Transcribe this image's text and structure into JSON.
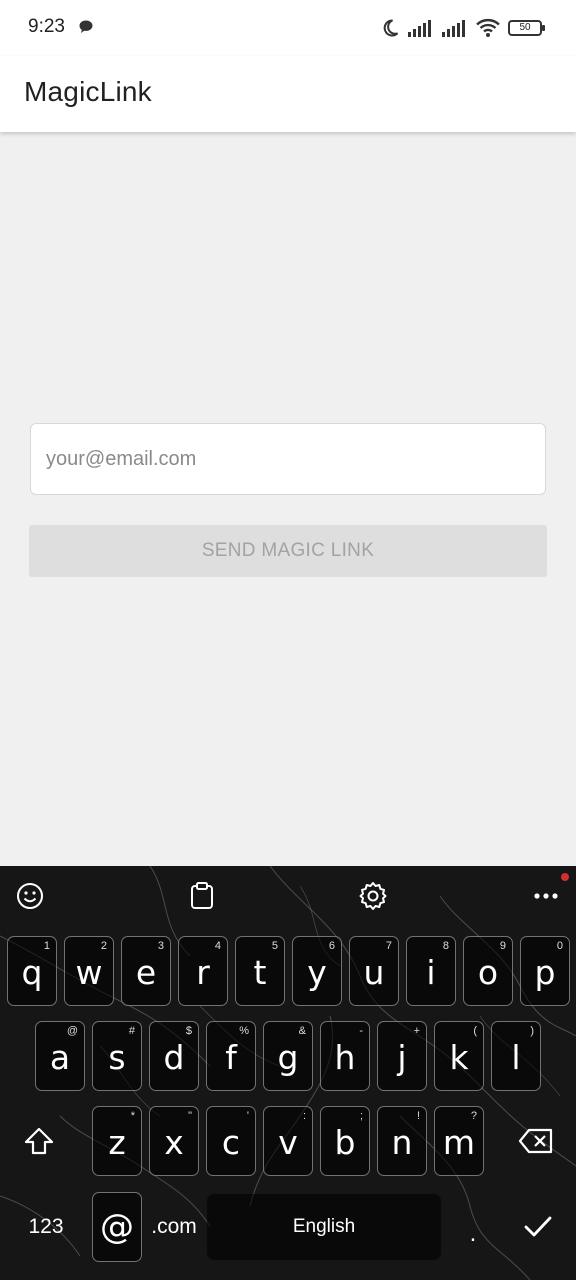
{
  "status_bar": {
    "time": "9:23",
    "battery": "50",
    "icons": [
      "message-icon",
      "moon-icon",
      "signal-icon",
      "signal-icon",
      "wifi-icon",
      "battery-icon"
    ]
  },
  "app_bar": {
    "title": "MagicLink"
  },
  "form": {
    "email": {
      "placeholder": "your@email.com",
      "value": ""
    },
    "send_label": "SEND MAGIC LINK"
  },
  "keyboard": {
    "toolbar": [
      "emoji-icon",
      "clipboard-icon",
      "settings-icon",
      "more-icon"
    ],
    "rows": [
      [
        {
          "k": "q",
          "h": "1"
        },
        {
          "k": "w",
          "h": "2"
        },
        {
          "k": "e",
          "h": "3"
        },
        {
          "k": "r",
          "h": "4"
        },
        {
          "k": "t",
          "h": "5"
        },
        {
          "k": "y",
          "h": "6"
        },
        {
          "k": "u",
          "h": "7"
        },
        {
          "k": "i",
          "h": "8"
        },
        {
          "k": "o",
          "h": "9"
        },
        {
          "k": "p",
          "h": "0"
        }
      ],
      [
        {
          "k": "a",
          "h": "@"
        },
        {
          "k": "s",
          "h": "#"
        },
        {
          "k": "d",
          "h": "$"
        },
        {
          "k": "f",
          "h": "%"
        },
        {
          "k": "g",
          "h": "&"
        },
        {
          "k": "h",
          "h": "-"
        },
        {
          "k": "j",
          "h": "+"
        },
        {
          "k": "k",
          "h": "("
        },
        {
          "k": "l",
          "h": ")"
        }
      ],
      [
        {
          "k": "z",
          "h": "*"
        },
        {
          "k": "x",
          "h": "\""
        },
        {
          "k": "c",
          "h": "'"
        },
        {
          "k": "v",
          "h": ":"
        },
        {
          "k": "b",
          "h": ";"
        },
        {
          "k": "n",
          "h": "!"
        },
        {
          "k": "m",
          "h": "?"
        }
      ]
    ],
    "numbers_label": "123",
    "at_label": "@",
    "dotcom_label": ".com",
    "space_label": "English",
    "period_label": "."
  }
}
